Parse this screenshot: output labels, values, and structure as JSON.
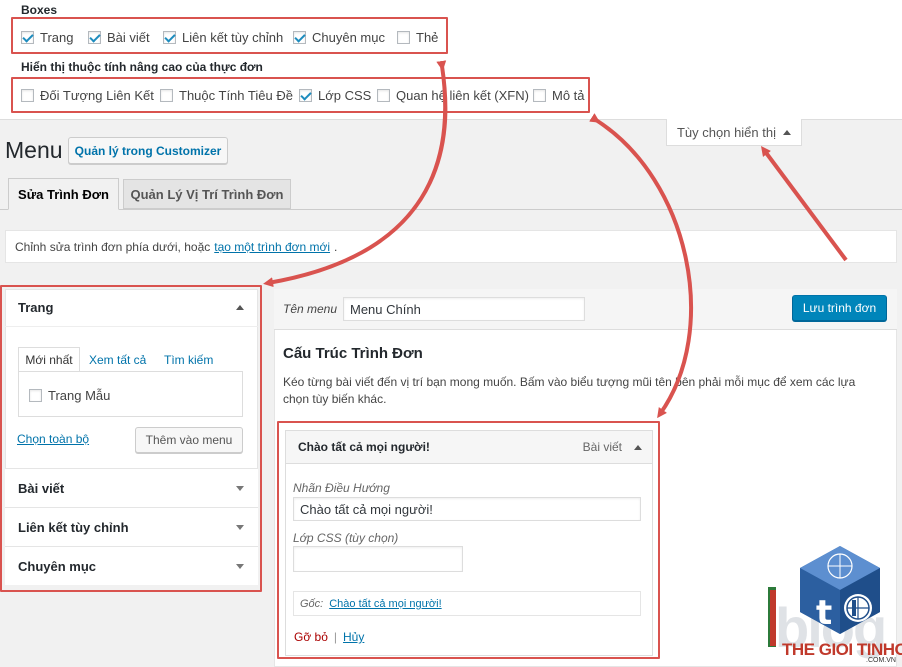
{
  "screen_options": {
    "boxes_title": "Boxes",
    "boxes": [
      {
        "label": "Trang",
        "checked": true
      },
      {
        "label": "Bài viết",
        "checked": true
      },
      {
        "label": "Liên kết tùy chỉnh",
        "checked": true
      },
      {
        "label": "Chuyên mục",
        "checked": true
      },
      {
        "label": "Thẻ",
        "checked": false
      }
    ],
    "advanced_title": "Hiển thị thuộc tính nâng cao của thực đơn",
    "advanced": [
      {
        "label": "Đối Tượng Liên Kết",
        "checked": false
      },
      {
        "label": "Thuộc Tính Tiêu Đề",
        "checked": false
      },
      {
        "label": "Lớp CSS",
        "checked": true
      },
      {
        "label": "Quan hệ liên kết (XFN)",
        "checked": false
      },
      {
        "label": "Mô tả",
        "checked": false
      }
    ],
    "toggle_label": "Tùy chọn hiển thị"
  },
  "header": {
    "title": "Menu",
    "customizer_button": "Quản lý trong Customizer"
  },
  "tabs": [
    {
      "label": "Sửa Trình Đơn",
      "active": true
    },
    {
      "label": "Quản Lý Vị Trí Trình Đơn",
      "active": false
    }
  ],
  "notice": {
    "text": "Chỉnh sửa trình đơn phía dưới, hoặc",
    "link": "tạo một trình đơn mới",
    "suffix": "."
  },
  "left_panel": {
    "pages_title": "Trang",
    "subtabs": [
      "Mới nhất",
      "Xem tất cả",
      "Tìm kiếm"
    ],
    "page_item": "Trang Mẫu",
    "select_all": "Chọn toàn bộ",
    "add_button": "Thêm vào menu",
    "sections": [
      "Bài viết",
      "Liên kết tùy chỉnh",
      "Chuyên mục"
    ]
  },
  "menu_editor": {
    "name_label": "Tên menu",
    "name_value": "Menu Chính",
    "save_button": "Lưu trình đơn",
    "structure_title": "Cấu Trúc Trình Đơn",
    "instructions": "Kéo từng bài viết đến vị trí bạn mong muốn. Bấm vào biểu tượng mũi tên bên phải mỗi mục để xem các lựa chọn tùy biến khác.",
    "item": {
      "title": "Chào tất cả mọi người!",
      "type": "Bài viết",
      "nav_label_caption": "Nhãn Điều Hướng",
      "nav_label_value": "Chào tất cả mọi người!",
      "css_caption": "Lớp CSS (tùy chọn)",
      "css_value": "",
      "original_caption": "Gốc:",
      "original_link": "Chào tất cả mọi người!",
      "remove": "Gỡ bỏ",
      "separator": "|",
      "cancel": "Hủy"
    }
  },
  "watermark": {
    "text": "THE GIOI TINHOC",
    "domain": ".COM.VN"
  },
  "colors": {
    "annotation_red": "#d9534f",
    "primary_button": "#0085ba",
    "link": "#0073aa"
  }
}
